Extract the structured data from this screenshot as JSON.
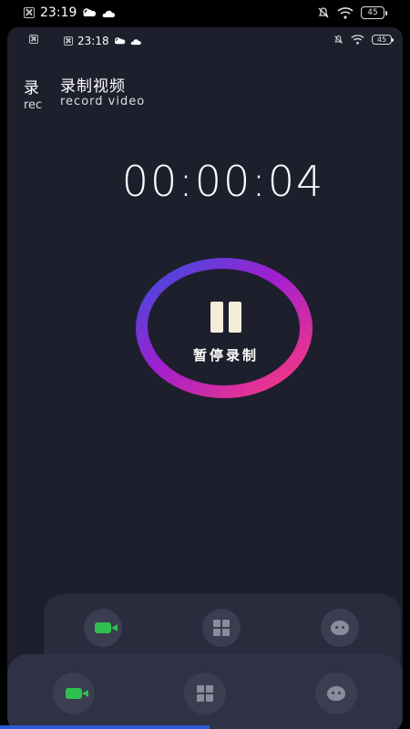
{
  "status": {
    "time": "23:19",
    "battery": "45"
  },
  "inner_status": {
    "time": "23:18",
    "battery": "45"
  },
  "header": {
    "title_cn": "录制视频",
    "title_en": "record video",
    "ghost_cn": "录",
    "ghost_en": "rec"
  },
  "timer": "00:00:04",
  "record_button": {
    "label": "暂停录制"
  },
  "colors": {
    "ring_start": "#3b4fe0",
    "ring_mid": "#a01fd0",
    "ring_end": "#ff3a7a",
    "bg": "#1d1f2d"
  },
  "tabs": [
    {
      "icon": "video-camera-icon"
    },
    {
      "icon": "apps-grid-icon"
    },
    {
      "icon": "chat-face-icon"
    }
  ]
}
